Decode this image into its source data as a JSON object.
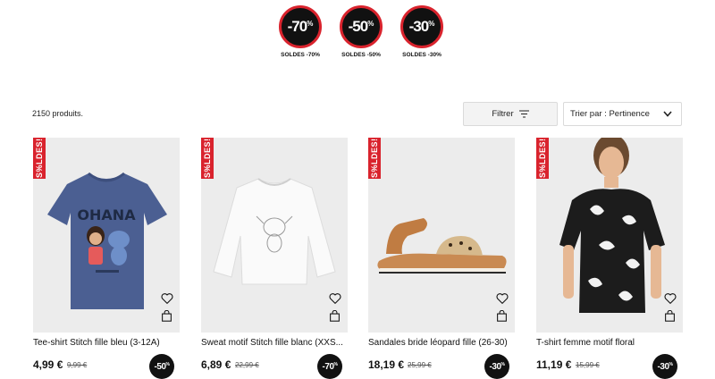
{
  "promos": [
    {
      "badge": "-70",
      "label": "SOLDES -70%"
    },
    {
      "badge": "-50",
      "label": "SOLDES -50%"
    },
    {
      "badge": "-30",
      "label": "SOLDES -30%"
    }
  ],
  "toolbar": {
    "count": "2150 produits.",
    "filter_label": "Filtrer",
    "sort_label": "Trier par : Pertinence"
  },
  "colors": {
    "accent_red": "#d9232d",
    "badge_black": "#111111",
    "image_bg": "#ececec"
  },
  "products": [
    {
      "tag": "S%LDES!",
      "name": "Tee-shirt Stitch fille bleu (3-12A)",
      "price": "4,99 €",
      "old_price": "9,99 €",
      "discount": "-50"
    },
    {
      "tag": "S%LDES!",
      "name": "Sweat motif Stitch fille blanc (XXS...",
      "price": "6,89 €",
      "old_price": "22,99 €",
      "discount": "-70"
    },
    {
      "tag": "S%LDES!",
      "name": "Sandales bride léopard fille (26-30)",
      "price": "18,19 €",
      "old_price": "25,99 €",
      "discount": "-30"
    },
    {
      "tag": "S%LDES!",
      "name": "T-shirt femme motif floral",
      "price": "11,19 €",
      "old_price": "15,99 €",
      "discount": "-30"
    }
  ],
  "images": {
    "product_1": {
      "shirt_text": "OHANA"
    }
  },
  "icons": [
    "heart-icon",
    "shopping-bag-icon",
    "filter-icon",
    "chevron-down-icon"
  ]
}
